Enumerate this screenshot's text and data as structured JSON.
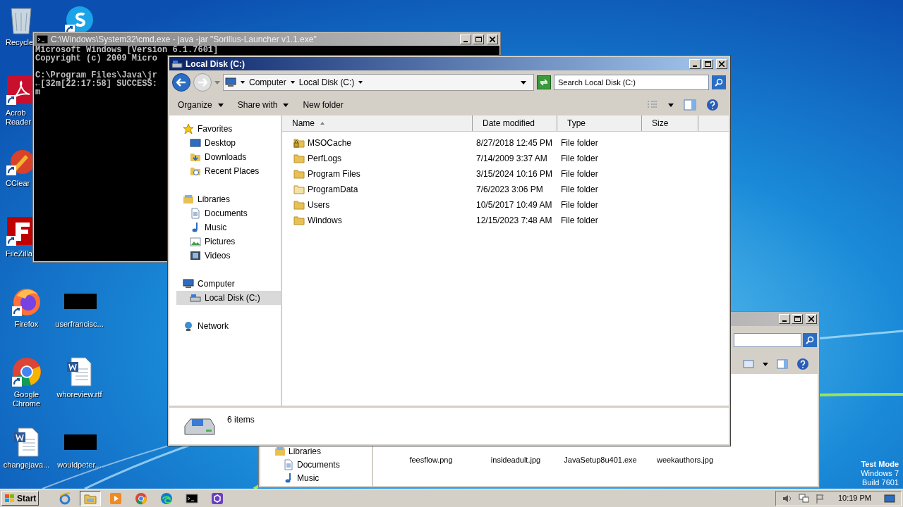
{
  "desktop": {
    "left_column": [
      {
        "kind": "recycle",
        "label": "Recycle",
        "covered": true
      },
      {
        "kind": "pdf",
        "label": "Acrob Reader",
        "covered": true
      },
      {
        "kind": "ccleaner",
        "label": "CClear",
        "covered": true
      },
      {
        "kind": "filezilla",
        "label": "FileZilla",
        "covered": true
      },
      {
        "kind": "firefox",
        "label": "Firefox",
        "covered": false
      },
      {
        "kind": "chrome",
        "label": "Google Chrome",
        "covered": false
      },
      {
        "kind": "word",
        "label": "changejava...",
        "covered": false
      }
    ],
    "right_column_top": [
      {
        "kind": "skype"
      }
    ],
    "right_column_bottom": [
      {
        "kind": "redacted",
        "label": "userfrancisc..."
      },
      {
        "kind": "word",
        "label": "whoreview.rtf"
      },
      {
        "kind": "redacted",
        "label": "wouldpeter..."
      }
    ],
    "test_mode": [
      "Test Mode",
      "Windows 7",
      "Build 7601"
    ]
  },
  "cmd_window": {
    "title": "C:\\Windows\\System32\\cmd.exe - java  -jar \"Sorillus-Launcher v1.1.exe\"",
    "paragraphs": [
      [
        "Microsoft Windows [Version 6.1.7601]",
        "Copyright (c) 2009 Micro"
      ],
      [
        "C:\\Program Files\\Java\\jr",
        "←[32m[22:17:58] SUCCESS:",
        "m"
      ]
    ]
  },
  "back_window": {
    "nav": [
      {
        "kind": "library",
        "label": "Libraries"
      },
      {
        "kind": "document",
        "label": "Documents"
      },
      {
        "kind": "music",
        "label": "Music"
      }
    ],
    "files": [
      "feesflow.png",
      "insideadult.jpg",
      "JavaSetup8u401.exe",
      "weekauthors.jpg"
    ]
  },
  "explorer": {
    "title": "Local Disk (C:)",
    "breadcrumb": [
      "Computer",
      "Local Disk (C:)"
    ],
    "search": {
      "placeholder": "Search Local Disk (C:)"
    },
    "toolbar": [
      {
        "label": "Organize",
        "dropdown": true
      },
      {
        "label": "Share with",
        "dropdown": true
      },
      {
        "label": "New folder",
        "dropdown": false
      }
    ],
    "nav": [
      {
        "kind": "favorites",
        "label": "Favorites",
        "selected": false,
        "children": [
          {
            "kind": "desktop",
            "label": "Desktop",
            "selected": false
          },
          {
            "kind": "downloads",
            "label": "Downloads",
            "selected": false
          },
          {
            "kind": "recent",
            "label": "Recent Places",
            "selected": false
          }
        ]
      },
      {
        "kind": "library",
        "label": "Libraries",
        "selected": false,
        "children": [
          {
            "kind": "document",
            "label": "Documents",
            "selected": false
          },
          {
            "kind": "music",
            "label": "Music",
            "selected": false
          },
          {
            "kind": "pictures",
            "label": "Pictures",
            "selected": false
          },
          {
            "kind": "videos",
            "label": "Videos",
            "selected": false
          }
        ]
      },
      {
        "kind": "computer",
        "label": "Computer",
        "selected": false,
        "children": [
          {
            "kind": "drive",
            "label": "Local Disk (C:)",
            "selected": true
          }
        ]
      },
      {
        "kind": "network",
        "label": "Network",
        "selected": false
      }
    ],
    "columns": [
      {
        "label": "Name",
        "sorted": true
      },
      {
        "label": "Date modified",
        "sorted": false
      },
      {
        "label": "Type",
        "sorted": false
      },
      {
        "label": "Size",
        "sorted": false
      }
    ],
    "rows": [
      {
        "kind": "locked",
        "name": "MSOCache",
        "date": "8/27/2018 12:45 PM",
        "type": "File folder"
      },
      {
        "kind": "normal",
        "name": "PerfLogs",
        "date": "7/14/2009 3:37 AM",
        "type": "File folder"
      },
      {
        "kind": "normal",
        "name": "Program Files",
        "date": "3/15/2024 10:16 PM",
        "type": "File folder"
      },
      {
        "kind": "hidden",
        "name": "ProgramData",
        "date": "7/6/2023 3:06 PM",
        "type": "File folder"
      },
      {
        "kind": "normal",
        "name": "Users",
        "date": "10/5/2017 10:49 AM",
        "type": "File folder"
      },
      {
        "kind": "normal",
        "name": "Windows",
        "date": "12/15/2023 7:48 AM",
        "type": "File folder"
      }
    ],
    "status": "6 items"
  },
  "taskbar": {
    "start": "Start",
    "apps": [
      {
        "kind": "ie",
        "active": false
      },
      {
        "kind": "explorer",
        "active": true
      },
      {
        "kind": "media",
        "active": false
      },
      {
        "kind": "chrome",
        "active": false
      },
      {
        "kind": "edge",
        "active": false
      },
      {
        "kind": "cmd",
        "active": false
      },
      {
        "kind": "hex",
        "active": false
      }
    ],
    "clock": "10:19 PM"
  }
}
